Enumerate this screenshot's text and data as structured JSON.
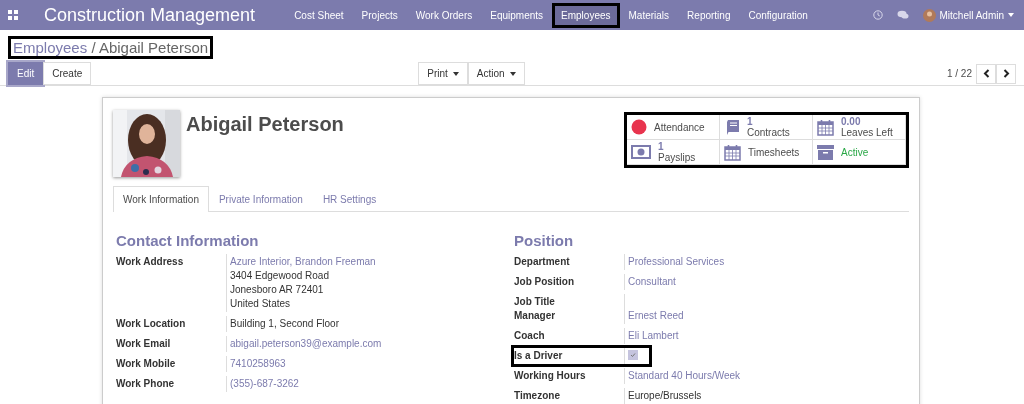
{
  "navbar": {
    "app_title": "Construction Management",
    "menu": [
      {
        "label": "Cost Sheet",
        "selected": false,
        "highlighted": false
      },
      {
        "label": "Projects",
        "selected": false,
        "highlighted": false
      },
      {
        "label": "Work Orders",
        "selected": false,
        "highlighted": false
      },
      {
        "label": "Equipments",
        "selected": false,
        "highlighted": false
      },
      {
        "label": "Employees",
        "selected": true,
        "highlighted": true
      },
      {
        "label": "Materials",
        "selected": false,
        "highlighted": false
      },
      {
        "label": "Reporting",
        "selected": false,
        "highlighted": false
      },
      {
        "label": "Configuration",
        "selected": false,
        "highlighted": false
      }
    ],
    "user": "Mitchell Admin"
  },
  "breadcrumb": {
    "highlighted": true,
    "separator": "/",
    "items": [
      "Employees",
      "Abigail Peterson"
    ]
  },
  "buttons": [
    {
      "label": "Edit",
      "kind": "primary"
    },
    {
      "label": "Create",
      "kind": "secondary"
    }
  ],
  "dropdowns": [
    "Print",
    "Action"
  ],
  "pager": "1 / 22",
  "employee": {
    "name": "Abigail Peterson"
  },
  "stat_buttons": {
    "highlighted": true,
    "items": [
      {
        "kind": "attendance",
        "label": "Attendance"
      },
      {
        "kind": "book",
        "value": "1",
        "label": "Contracts"
      },
      {
        "kind": "calendar",
        "value": "0.00",
        "label": "Leaves Left"
      },
      {
        "kind": "money",
        "value": "1",
        "label": "Payslips"
      },
      {
        "kind": "calendar",
        "label": "Timesheets"
      },
      {
        "kind": "archive",
        "label": "Active"
      }
    ]
  },
  "tabs": [
    {
      "label": "Work Information",
      "selected": true
    },
    {
      "label": "Private Information",
      "selected": false
    },
    {
      "label": "HR Settings",
      "selected": false
    }
  ],
  "groups": [
    {
      "title": "Contact Information",
      "fields": [
        {
          "label": "Work Address",
          "highlighted": false,
          "values": [
            {
              "kind": "link",
              "text": "Azure Interior, Brandon Freeman"
            },
            {
              "kind": "text",
              "text": "3404 Edgewood Road"
            },
            {
              "kind": "text",
              "text": "Jonesboro AR 72401"
            },
            {
              "kind": "text",
              "text": "United States"
            }
          ]
        },
        {
          "label": "Work Location",
          "highlighted": false,
          "values": [
            {
              "kind": "text",
              "text": "Building 1, Second Floor"
            }
          ]
        },
        {
          "label": "Work Email",
          "highlighted": false,
          "values": [
            {
              "kind": "link",
              "text": "abigail.peterson39@example.com"
            }
          ]
        },
        {
          "label": "Work Mobile",
          "highlighted": false,
          "values": [
            {
              "kind": "link",
              "text": "7410258963"
            }
          ]
        },
        {
          "label": "Work Phone",
          "highlighted": false,
          "values": [
            {
              "kind": "link",
              "text": "(355)-687-3262"
            }
          ]
        }
      ]
    },
    {
      "title": "Position",
      "fields": [
        {
          "label": "Department",
          "highlighted": false,
          "values": [
            {
              "kind": "link",
              "text": "Professional Services"
            }
          ]
        },
        {
          "label": "Job Position",
          "highlighted": false,
          "values": [
            {
              "kind": "link",
              "text": "Consultant"
            }
          ]
        },
        {
          "label": "Job Title",
          "highlighted": false
        },
        {
          "label": "Manager",
          "highlighted": false,
          "values": [
            {
              "kind": "link",
              "text": "Ernest Reed"
            }
          ]
        },
        {
          "label": "Coach",
          "highlighted": false,
          "values": [
            {
              "kind": "link",
              "text": "Eli Lambert"
            }
          ]
        },
        {
          "label": "Is a Driver",
          "highlighted": true,
          "values": [
            {
              "kind": "checkbox",
              "checked": true
            }
          ]
        },
        {
          "label": "Working Hours",
          "highlighted": false,
          "values": [
            {
              "kind": "link",
              "text": "Standard 40 Hours/Week"
            }
          ]
        },
        {
          "label": "Timezone",
          "highlighted": false,
          "values": [
            {
              "kind": "text",
              "text": "Europe/Brussels"
            }
          ]
        }
      ]
    }
  ]
}
